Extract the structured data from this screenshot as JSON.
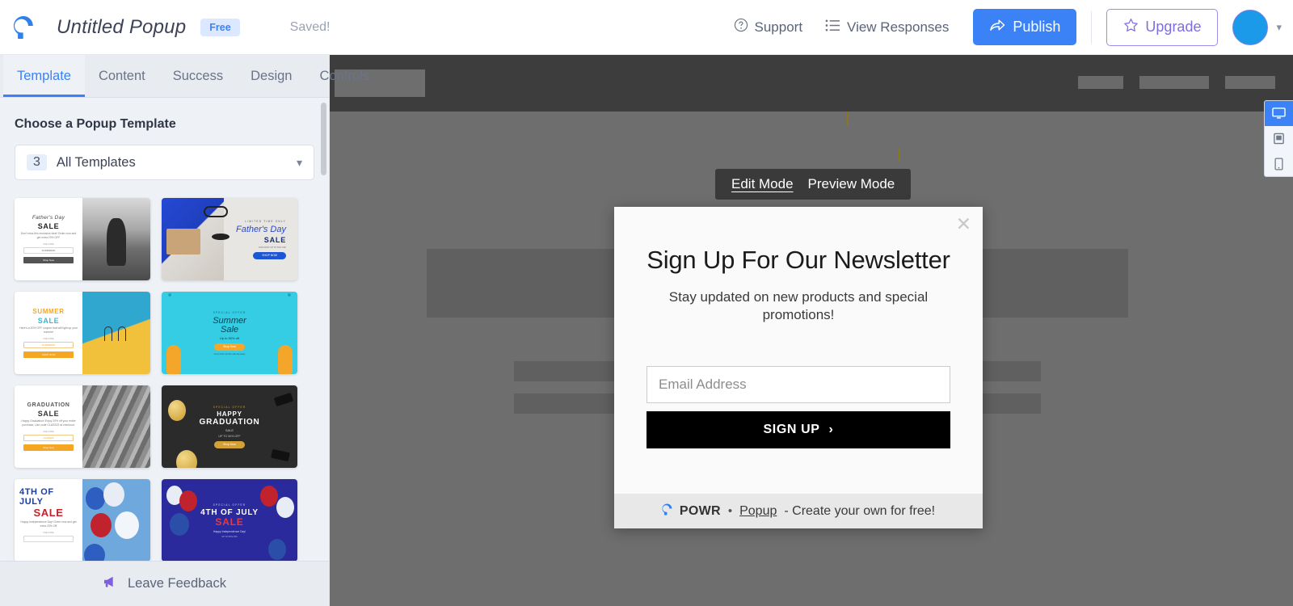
{
  "topbar": {
    "logo_icon": "powr-logo-icon",
    "doc_title": "Untitled Popup",
    "plan_badge": "Free",
    "save_status": "Saved!",
    "support_label": "Support",
    "support_icon": "question-circle-icon",
    "view_responses_label": "View Responses",
    "view_responses_icon": "list-icon",
    "publish_label": "Publish",
    "publish_icon": "share-arrow-icon",
    "upgrade_label": "Upgrade",
    "upgrade_icon": "star-icon",
    "avatar_caret_icon": "chevron-down-icon",
    "accent_blue": "#3b82f6",
    "upgrade_purple": "#7c6ee0",
    "avatar_color": "#1a9ae8"
  },
  "sidebar": {
    "tabs": [
      {
        "label": "Template",
        "active": true
      },
      {
        "label": "Content",
        "active": false
      },
      {
        "label": "Success",
        "active": false
      },
      {
        "label": "Design",
        "active": false
      },
      {
        "label": "Controls",
        "active": false
      }
    ],
    "panel_heading": "Choose a Popup Template",
    "filter": {
      "count": "3",
      "label": "All Templates",
      "caret_icon": "chevron-down-icon"
    },
    "templates": [
      {
        "name": "fathers-day-sale-split",
        "style": "split-light",
        "title": "Father's Day",
        "subtitle": "SALE",
        "body": "Don't miss this exclusive deal! Order now and get extra 20% OFF",
        "tiny": "USE CODE",
        "field": "SUPERDAD",
        "button": "Shop Now",
        "button_color": "#545454",
        "image": "father-and-child-bw"
      },
      {
        "name": "fathers-day-sale-banner",
        "style": "full-light",
        "eyebrow": "LIMITED TIME ONLY",
        "title": "Father's Day",
        "subtitle": "SALE",
        "body": "DISCOUNT UP TO 50% OFF",
        "button": "SHOP NOW",
        "button_color": "#1a56d6",
        "bg": "#e8e6e3"
      },
      {
        "name": "summer-sale-split",
        "style": "split-light",
        "title": "SUMMER",
        "subtitle": "SALE",
        "body": "Here's a 20% OFF coupon that will light up your summer",
        "tiny": "USE CODE",
        "field": "SUMMER20",
        "button": "SHOP NOW",
        "button_color": "#f5a623",
        "image": "pool-ladder-yellow"
      },
      {
        "name": "summer-sale-banner",
        "style": "full-cyan",
        "eyebrow": "SPECIAL OFFER",
        "title": "Summer",
        "subtitle": "Sale",
        "body": "Up to 50% off",
        "button": "Shop Now",
        "button_color": "#f5a623",
        "note": "Hurry! Don't let this sale slip away",
        "bg": "#35cde4"
      },
      {
        "name": "graduation-sale-split",
        "style": "split-light",
        "title": "GRADUATION",
        "subtitle": "SALE",
        "body": "Happy Graduation! Enjoy 20% off your entire purchase. Use code CLASS22 at checkout.",
        "tiny": "USE CODE",
        "field": "CLASS22",
        "button": "Shop Now",
        "button_color": "#f5a623",
        "image": "graduation-caps-bw"
      },
      {
        "name": "graduation-sale-banner",
        "style": "full-dark",
        "eyebrow": "SPECIAL OFFER",
        "title": "HAPPY",
        "subtitle": "GRADUATION",
        "subtitle2": "SALE",
        "body": "UP TO 50% OFF",
        "button": "Shop Now",
        "button_color": "#d4a137",
        "bg": "#2b2b2b"
      },
      {
        "name": "july-4th-sale-split",
        "style": "split-light",
        "title": "4TH OF JULY",
        "subtitle": "SALE",
        "body": "Happy Independence Day! Order now and get extra 20% Off",
        "tiny": "USE CODE",
        "image": "july4-balloons-sky"
      },
      {
        "name": "july-4th-sale-banner",
        "style": "full-navy",
        "eyebrow": "SPECIAL OFFER",
        "title": "4TH OF JULY",
        "subtitle": "SALE",
        "body": "Happy Independence Day!",
        "note": "UP TO 50% OFF",
        "bg": "#2a2a9c"
      }
    ],
    "footer": {
      "label": "Leave Feedback",
      "icon": "megaphone-icon"
    }
  },
  "canvas": {
    "mode_toggle": {
      "edit_label": "Edit Mode",
      "preview_label": "Preview Mode",
      "active": "Edit Mode"
    },
    "device_bar": [
      {
        "name": "desktop-icon",
        "active": true
      },
      {
        "name": "tablet-icon",
        "active": false
      },
      {
        "name": "mobile-icon",
        "active": false
      }
    ]
  },
  "popup": {
    "close_icon": "close-icon",
    "title": "Sign Up For Our Newsletter",
    "subtitle": "Stay updated on new products and special promotions!",
    "email_placeholder": "Email Address",
    "submit_label": "SIGN UP",
    "submit_arrow": "›",
    "footer": {
      "brand_icon": "powr-logo-icon",
      "brand": "POWR",
      "dot": "•",
      "link": "Popup",
      "text": "- Create your own for free!"
    }
  }
}
